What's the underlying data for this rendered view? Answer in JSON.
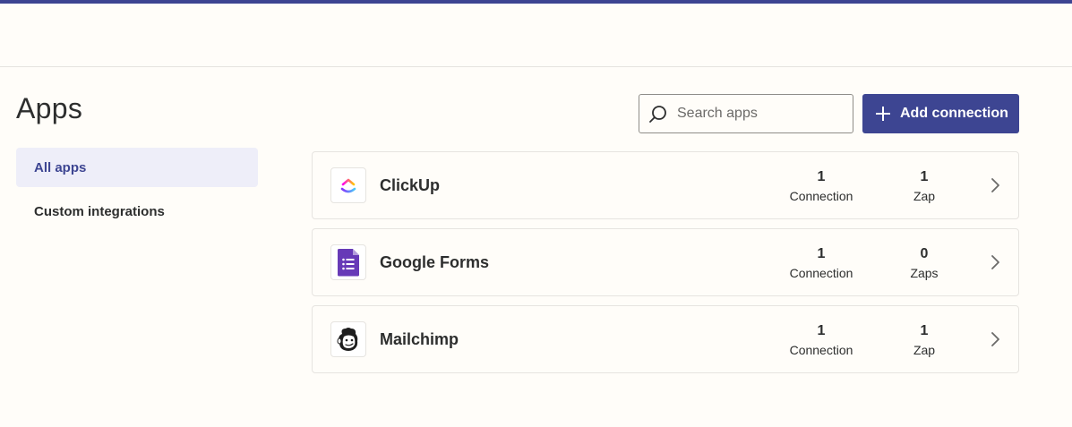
{
  "page": {
    "title": "Apps"
  },
  "sidebar": {
    "items": [
      {
        "label": "All apps"
      },
      {
        "label": "Custom integrations"
      }
    ]
  },
  "search": {
    "placeholder": "Search apps",
    "icon": "search-icon"
  },
  "toolbar": {
    "add_label": "Add connection",
    "icon": "plus-icon"
  },
  "apps": [
    {
      "name": "ClickUp",
      "icon": "clickup-logo-icon",
      "connections": "1",
      "connections_label": "Connection",
      "zaps": "1",
      "zaps_label": "Zap"
    },
    {
      "name": "Google Forms",
      "icon": "google-forms-logo-icon",
      "connections": "1",
      "connections_label": "Connection",
      "zaps": "0",
      "zaps_label": "Zaps"
    },
    {
      "name": "Mailchimp",
      "icon": "mailchimp-logo-icon",
      "connections": "1",
      "connections_label": "Connection",
      "zaps": "1",
      "zaps_label": "Zap"
    }
  ],
  "colors": {
    "accent": "#3d4592",
    "selected_bg": "#eeeef9",
    "background": "#fffdf9",
    "border": "#e6e4e0"
  }
}
